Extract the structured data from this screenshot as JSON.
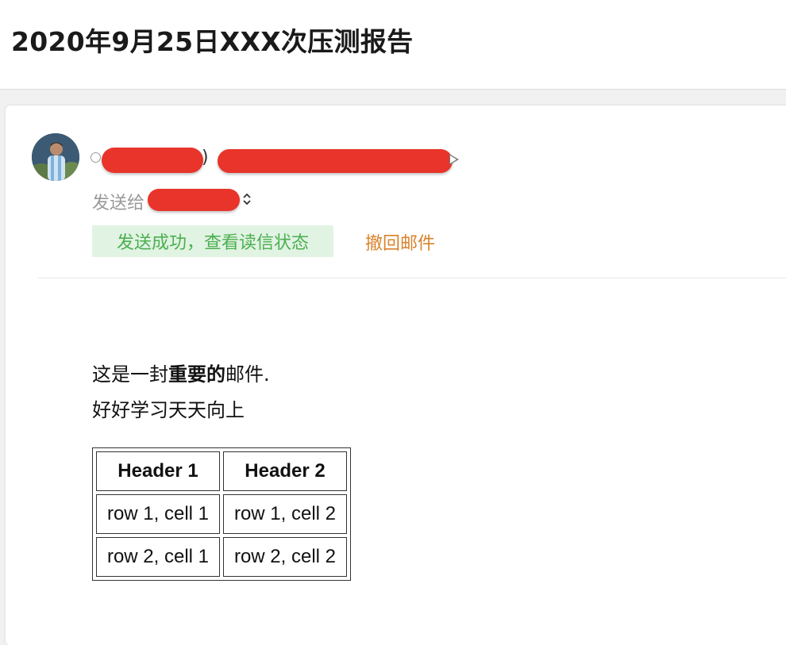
{
  "email": {
    "subject": "2020年9月25日XXX次压测报告",
    "sender": {
      "close_paren": ")"
    },
    "recipient_label": "发送给",
    "status_badge": "发送成功，查看读信状态",
    "recall_link": "撤回邮件",
    "body": {
      "line1_before": "这是一封",
      "line1_bold": "重要的",
      "line1_after": "邮件.",
      "line2": "好好学习天天向上"
    },
    "table": {
      "headers": [
        "Header 1",
        "Header 2"
      ],
      "rows": [
        [
          "row 1, cell 1",
          "row 1, cell 2"
        ],
        [
          "row 2, cell 1",
          "row 2, cell 2"
        ]
      ]
    }
  },
  "colors": {
    "redaction": "#e8342a",
    "success_bg": "#e1f3e3",
    "success_text": "#4caf50",
    "recall_text": "#d9822b"
  },
  "icons": {
    "avatar": "avatar",
    "status": "status-dot-icon",
    "expand": "chevron-right-icon",
    "recipients_toggle": "up-down-chevron-icon"
  }
}
